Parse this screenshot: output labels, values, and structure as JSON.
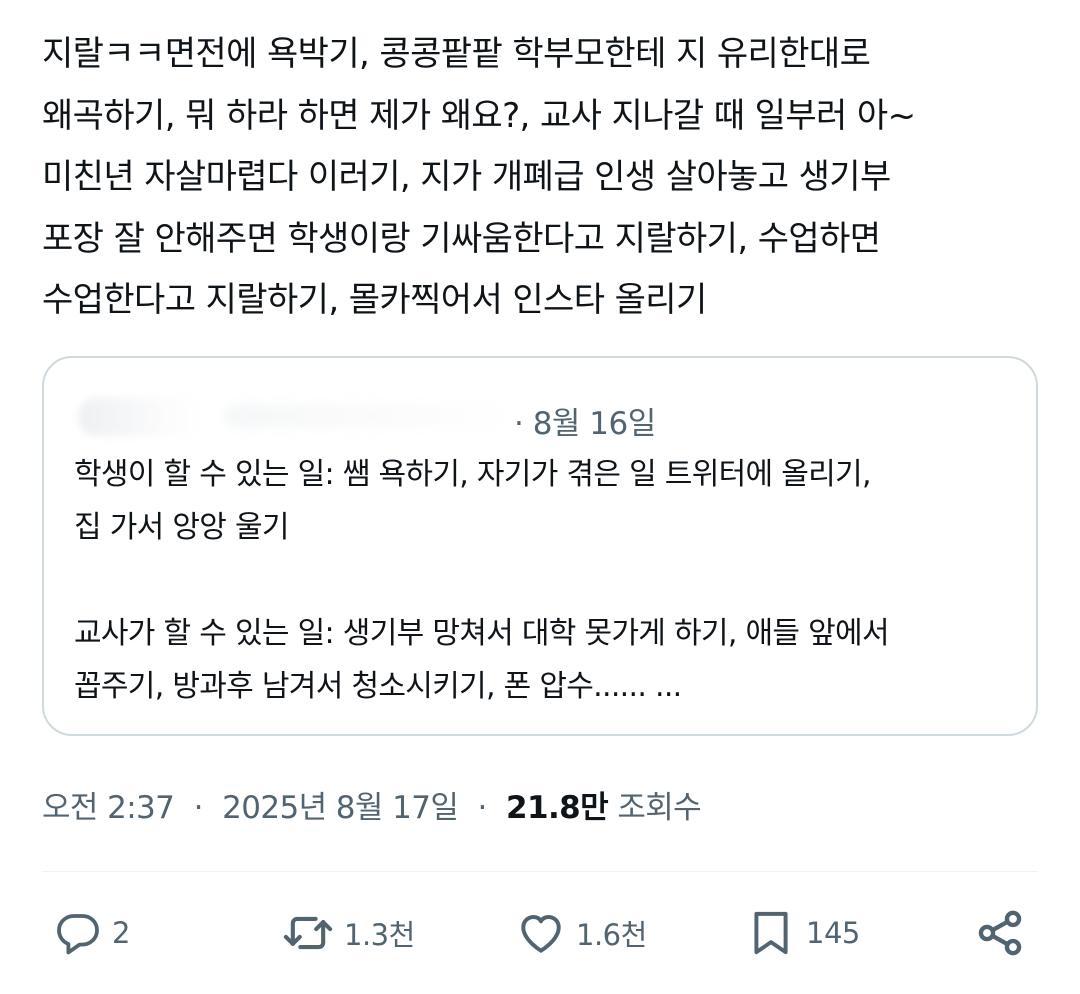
{
  "tweet": {
    "text": "지랄ㅋㅋ면전에 욕박기, 콩콩팥팥 학부모한테 지 유리한대로\n왜곡하기, 뭐 하라 하면 제가 왜요?, 교사 지나갈 때 일부러 아~\n미친년 자살마렵다 이러기, 지가 개폐급 인생 살아놓고 생기부\n포장 잘 안해주면 학생이랑 기싸움한다고 지랄하기, 수업하면\n수업한다고 지랄하기, 몰카찍어서 인스타 올리기"
  },
  "quote": {
    "date": "· 8월 16일",
    "text": "학생이 할 수 있는 일: 쌤 욕하기, 자기가 겪은 일 트위터에 올리기,\n집 가서 앙앙 울기\n\n교사가 할 수 있는 일: 생기부 망쳐서 대학 못가게 하기, 애들 앞에서\n꼽주기, 방과후 남겨서 청소시키기, 폰 압수...... ..."
  },
  "meta": {
    "time": "오전 2:37",
    "date": "2025년 8월 17일",
    "views_count": "21.8만",
    "views_label": "조회수",
    "separator": "·"
  },
  "actions": {
    "reply": {
      "icon": "reply-icon",
      "count": "2"
    },
    "retweet": {
      "icon": "retweet-icon",
      "count": "1.3천"
    },
    "like": {
      "icon": "heart-icon",
      "count": "1.6천"
    },
    "bookmark": {
      "icon": "bookmark-icon",
      "count": "145"
    },
    "share": {
      "icon": "share-icon"
    }
  },
  "colors": {
    "text_primary": "#0f1419",
    "text_secondary": "#536471",
    "border": "#cfd9de",
    "divider": "#eff3f4"
  }
}
